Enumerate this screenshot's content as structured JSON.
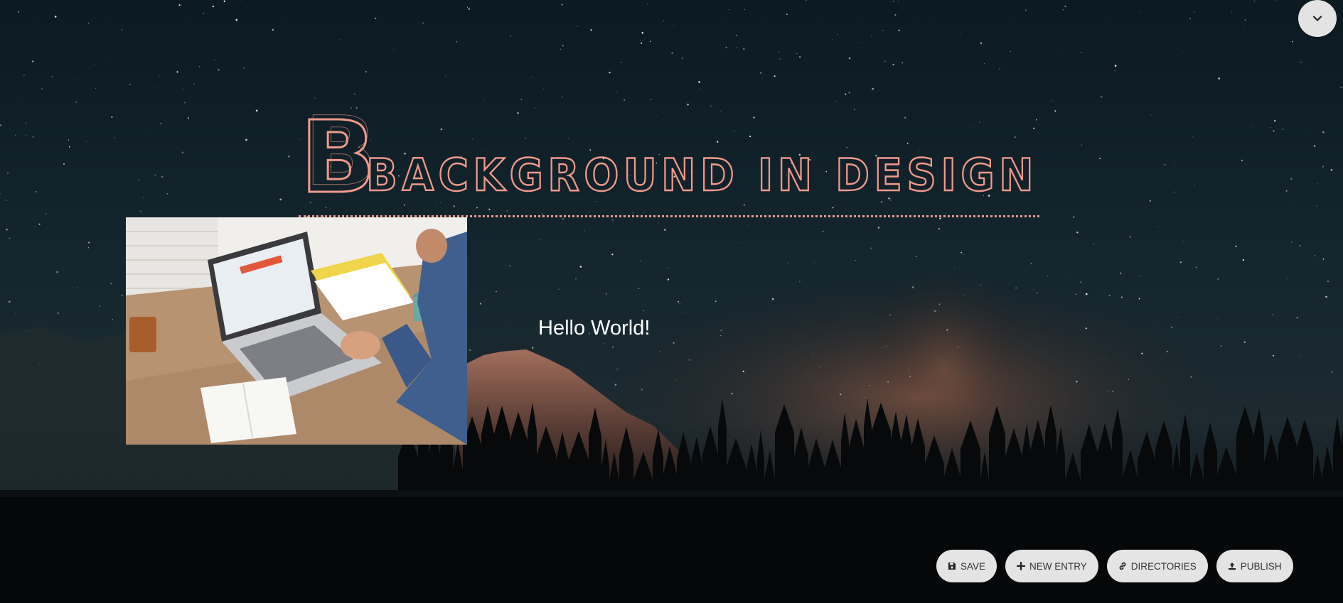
{
  "header": {
    "title": "Background in design",
    "collapse_icon": "chevron-down-icon"
  },
  "content": {
    "text": "Hello World!",
    "image_subject": "person using laptop on desk"
  },
  "toolbar": {
    "buttons": [
      {
        "label": "SAVE",
        "icon": "save-icon"
      },
      {
        "label": "NEW ENTRY",
        "icon": "plus-icon"
      },
      {
        "label": "DIRECTORIES",
        "icon": "link-icon"
      },
      {
        "label": "PUBLISH",
        "icon": "upload-icon"
      }
    ]
  },
  "colors": {
    "title": "#f19a8b",
    "button_bg": "#e4e4e4",
    "text": "#ffffff"
  }
}
